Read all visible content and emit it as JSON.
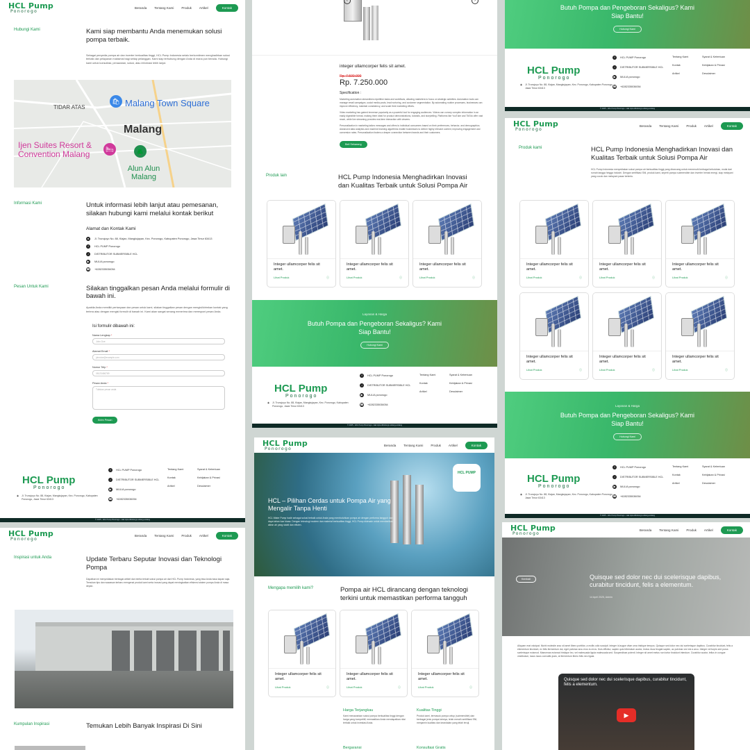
{
  "nav": {
    "logo_title": "HCL Pump",
    "logo_sub": "Ponorogo",
    "items": [
      "Beranda",
      "Tentang Kami",
      "Produk",
      "Artikel"
    ],
    "contact": "Kontak"
  },
  "contact_page": {
    "intro_label": "Hubungi Kami",
    "intro_title": "Kami siap membantu Anda menemukan solusi pompa terbaik.",
    "intro_text": "Sebagai penyedia pompa air dan inverter berkualitas tinggi, HCL Pump Indonesia selalu berkomitmen menghadirkan solusi terbaik dan pelayanan maksimal bagi setiap pelanggan. Kami siap terhubung dengan Anda di mana pun berada. Hubungi kami untuk konsultasi, penawaran, solusi, atau informasi lebih lanjut.",
    "map": {
      "label_area": "TIDAR ATAS",
      "label_square": "Malang Town Square",
      "label_city": "Malang",
      "label_hotel": "Ijen Suites Resort & Convention Malang",
      "label_park": "Alun Alun Malang"
    },
    "info_label": "Informasi Kami",
    "info_title": "Untuk informasi lebih lanjut atau pemesanan, silakan hubungi kami melalui kontak berikut",
    "address_heading": "Alamat dan Kontak Kami",
    "address": "Jl. Trunojoyo No. 88, Kiajan, Mangkujayan, Kec. Ponorogo, Kabupaten Ponorogo, Jawa Timur 63413",
    "contacts": [
      "HCL PUMP Ponorogo",
      "DISTRIBUTOR SUBMERSIBLE HCL",
      "MULIA ponorogo",
      "+6282335036054"
    ],
    "message_label": "Pesan Untuk Kami",
    "message_title": "Silakan tinggalkan pesan Anda melalui formulir di bawah ini.",
    "message_text": "Apabila Anda memiliki pertanyaan dan pesan untuk kami, silakan tinggalkan pesan dengan mengisi/kirimkan kontak yang tertera atau dengan mengisi formulir di bawah ini. Kami akan sangat senang menerima dan meresponi pesan Anda.",
    "form_heading": "Isi formulir dibawah ini:",
    "fields": [
      {
        "label": "Nama Lengkap",
        "placeholder": "John Doe"
      },
      {
        "label": "Alamat Email",
        "placeholder": "johndoe@example.com"
      },
      {
        "label": "Nomor Telp",
        "placeholder": "08123456789"
      },
      {
        "label": "Pesan Anda",
        "placeholder": "Tuliskan pesan anda"
      }
    ],
    "submit": "Kirim Pesan"
  },
  "footer": {
    "logo_title": "HCL Pump",
    "logo_sub": "Ponorogo",
    "address": "Jl. Trunojoyo No. 88, Kiajan, Mangkujayan, Kec. Ponorogo, Kabupaten Ponorogo, Jawa Timur 63413",
    "socials": [
      "HCL PUMP Ponorogo",
      "DISTRIBUTOR SUBMERSIBLE HCL",
      "MULIA ponorogo",
      "+6282335036054"
    ],
    "col1": [
      "Tentang Kami",
      "Kontak",
      "Artikel"
    ],
    "col2": [
      "Syarat & Ketentuan",
      "Kebijakan & Privasi",
      "Desclaimer"
    ],
    "copyright": "© 2025 - HCL Pump Ponorogo - Hak cipta dilindungi undang-undang"
  },
  "product_page": {
    "product_name": "integer ullamcorper felis sit amet.",
    "old_price": "Rp. 7.500.000",
    "price": "Rp. 7.250.000",
    "spec_heading": "Specification :",
    "spec_p1": "Marketing automation streamlines repetitive tasks and workflows, allowing marketers to focus on strategic activities. Automation tools can manage email campaigns, social media posts, lead nurturing, and customer segmentation. By automating routine processes, businesses can improve efficiency, maintain consistency, and scale their marketing efforts.",
    "spec_p2": "Video marketing has gained immense popularity as a powerful tool for engaging audiences. Videos can convey complex information in an easily digestible format, making them ideal for product demonstrations, tutorials, and storytelling. Platforms like YouTube and TikTok offer vast reach, while live streaming provides real-time interaction with viewers.",
    "spec_p3": "Personalization in marketing tailors messages and offers to individual consumers based on their preferences, behavior, and demographics. Advanced data analytics and machine learning algorithms enable businesses to deliver highly relevant content, improving engagement and conversion rates. Personalization fosters a deeper connection between brands and their customers.",
    "buy_button": "Beli Sekarang",
    "others_label": "Produk lain",
    "others_title": "HCL Pump Indonesia Menghadirkan Inovasi dan Kualitas Terbaik untuk Solusi Pompa Air"
  },
  "cards": [
    {
      "title": "Integer ullamcorper felis sit amet.",
      "link": "Lihat Produk"
    },
    {
      "title": "Integer ullamcorper felis sit amet.",
      "link": "Lihat Produk"
    },
    {
      "title": "Integer ullamcorper felis sit amet.",
      "link": "Lihat Produk"
    }
  ],
  "cta": {
    "kicker": "Layanan & Harga",
    "title": "Butuh Pompa dan Pengeboran Sekaligus? Kami Siap Bantu!",
    "button": "Hubungi Kami"
  },
  "products_page": {
    "label": "Produk kami",
    "title": "HCL Pump Indonesia Menghadirkan Inovasi dan Kualitas Terbaik untuk Solusi Pompa Air",
    "text": "HCL Pump Indonesia menyediakan solusi pompa air berkualitas tinggi yang dirancang untuk memenuhi berbagai kebutuhan, mulai dari rumah tangga hingga industri. Dengan sertifikasi SNI, produk kami, seperti pompa submersible dan inverter hemat energi, siap melayani yang cocok dan melayani pasar tertentu."
  },
  "home_page": {
    "hero_title": "HCL – Pilihan Cerdas untuk Pompa Air yang Mengalir Tanpa Henti",
    "hero_text": "HCL Water Pump hadir sebagai solusi terbaik untuk Anda yang membutuhkan pompa air dengan performa tangguh dan daya tahan luar biasa. Dengan teknologi modern dan material berkualitas tinggi, HCL Pump didesain untuk memberikan aliran air yang stabil dan efisien.",
    "why_label": "Mengapa memilih kami?",
    "why_title": "Pompa air HCL dirancang dengan teknologi terkini untuk memastikan performa tangguh",
    "feat1_title": "Harga Terjangkau",
    "feat1_text": "Kami menawarkan solusi pompa berkualitas tinggi dengan harga yang kompetitif, memastikan Anda mendapatkan nilai terbaik untuk investasi Anda.",
    "feat2_title": "Kualitas Tinggi",
    "feat2_text": "Produk kami, termasuk pompa celup (submersible) dan berbagai jenis pompa lainnya, telah meraih sertifikasi SNI, menjamin kualitas dan keandalan yang telah teruji.",
    "feat3_title": "Bergaransi",
    "feat4_title": "Konsultasi Gratis"
  },
  "articles_page": {
    "label": "Inspirasi untuk Anda",
    "title": "Update Terbaru Seputar Inovasi dan Teknologi Pompa",
    "text": "Dapatkan ini menyediakan berbagai artikel dan berita terkait solusi pompa air dari HCL Pump Indonesia, yang bisa Anda baca kapan saja. Temukan tips dan wawasan terbaru mengenai produk kami serta inovasi yang dapat meningkatkan efisiensi sistem pompa Anda di masa depan.",
    "more_label": "Kumpulan Inspirasi",
    "more_title": "Temukan Lebih Banyak Inspirasi Di Sini"
  },
  "blog_page": {
    "back": "Kembali",
    "title": "Quisque sed dolor nec dui scelerisque dapibus, curabitur tincidunt, felis a elementum.",
    "meta": "14 April 2025, Admin",
    "body": "Aliquam erat volutpat. Morbi molestie arcu sit amet libero porttitor, a mollis odio suscipit. Integer id augue vitae urna tristique tempus. Quisque sed dolor nec dui scelerisque dapibus. Curabitur tincidunt, felis a elementum tincidunt, ex felis fermentum dui, eget pulvinar arcu eros eu eros. Duis efficitur, sapien quis bibendum auctor, lectus risus feugiat sapien, ac pulvinar orci est a arcu. Integer vel turpis sed purus scelerisque euismod. Maecenas euismod tristique leo, vel malesuada ligula malesuada sed. Suspendisse potenti. Integer sit amet metus non tortor tincidunt interdum. Curabitur auctor, tellus in congue vestibulum, lacus lacus convallis justo, at fermentum libero felis nec ligula.",
    "video_title": "Quisque sed dolor nec dui scelerisque dapibus, curabitur tincidunt, felis a elementum."
  },
  "colors": {
    "brand": "#1d9a52",
    "footer_bar": "#0f2a26"
  }
}
